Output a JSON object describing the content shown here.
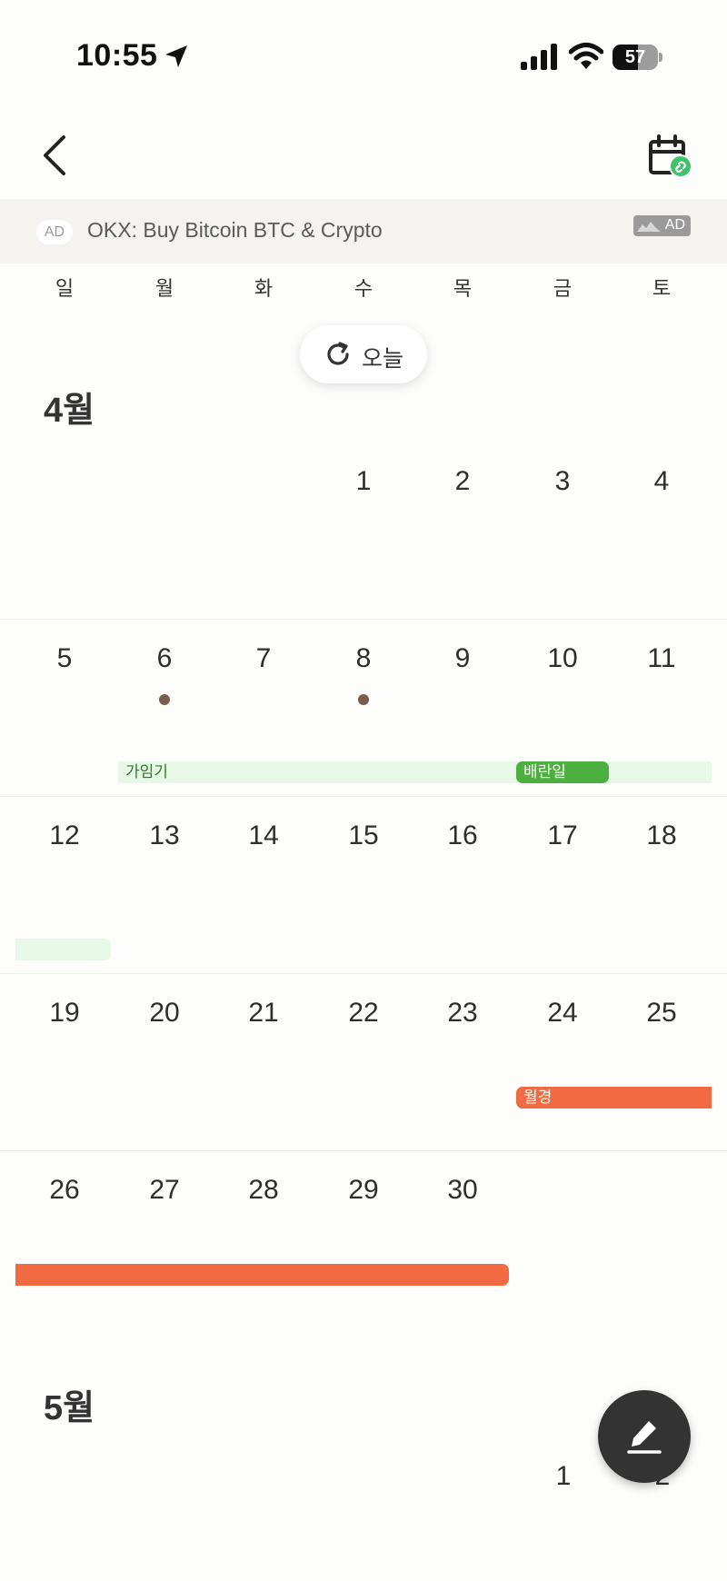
{
  "status_bar": {
    "time": "10:55",
    "battery": "57",
    "battery_level": 0.57
  },
  "ad": {
    "badge": "AD",
    "text": "OKX: Buy Bitcoin BTC & Crypto",
    "tag": "AD"
  },
  "weekdays": [
    "일",
    "월",
    "화",
    "수",
    "목",
    "금",
    "토"
  ],
  "today_button": {
    "label": "오늘"
  },
  "april": {
    "title": "4월",
    "weeks": [
      [
        "",
        "",
        "",
        "1",
        "2",
        "3",
        "4"
      ],
      [
        "5",
        "6",
        "7",
        "8",
        "9",
        "10",
        "11"
      ],
      [
        "12",
        "13",
        "14",
        "15",
        "16",
        "17",
        "18"
      ],
      [
        "19",
        "20",
        "21",
        "22",
        "23",
        "24",
        "25"
      ],
      [
        "26",
        "27",
        "28",
        "29",
        "30",
        "",
        ""
      ]
    ]
  },
  "events": {
    "fertile": "가임기",
    "ovulation": "배란일",
    "period": "월경"
  },
  "may": {
    "title": "5월",
    "days": [
      "1",
      "2"
    ]
  },
  "colors": {
    "fertile_bg": "#e8f8e6",
    "ovulation": "#4caf3f",
    "period": "#f26a42",
    "dot": "#7b5d4d"
  }
}
